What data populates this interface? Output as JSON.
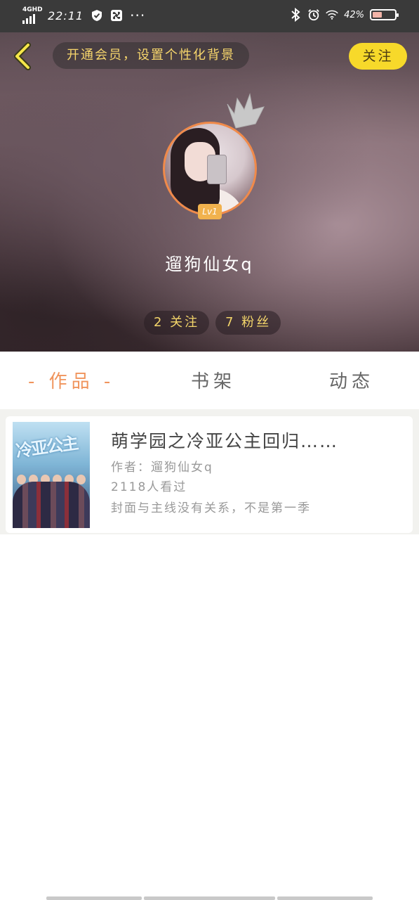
{
  "status_bar": {
    "network": "4GHD",
    "time": "22:11",
    "battery": "42%",
    "battery_level": 0.42
  },
  "header": {
    "vip_banner": "开通会员，设置个性化背景",
    "follow_label": "关注",
    "level": "Lv1",
    "username": "遛狗仙女q",
    "following_stat": "2 关注",
    "followers_stat": "7 粉丝"
  },
  "tabs": [
    {
      "label": "- 作品 -",
      "active": true
    },
    {
      "label": "书架",
      "active": false
    },
    {
      "label": "动态",
      "active": false
    }
  ],
  "book": {
    "title": "萌学园之冷亚公主回归……",
    "author": "作者：遛狗仙女q",
    "views": "2118人看过",
    "description": "封面与主线没有关系，不是第一季",
    "cover_text": "冷亚公主"
  },
  "colors": {
    "accent_orange": "#f0945c",
    "follow_yellow": "#f7d92a",
    "stat_text": "#f3d56a"
  }
}
